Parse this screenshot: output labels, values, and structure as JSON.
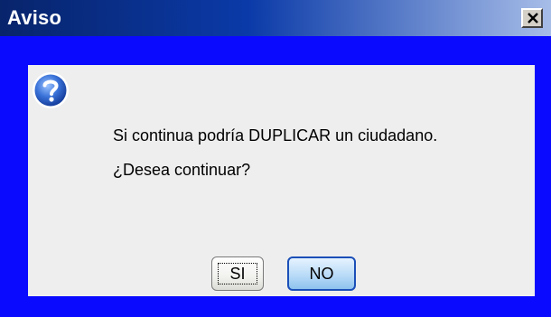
{
  "window": {
    "title": "Aviso"
  },
  "dialog": {
    "icon": "question-icon",
    "message_line1": "Si continua podría DUPLICAR un ciudadano.",
    "message_line2": "¿Desea continuar?",
    "yes_label": "SI",
    "no_label": "NO"
  },
  "colors": {
    "frame": "#0a0aff",
    "panel": "#eeeeee",
    "titlebar_start": "#08246b",
    "titlebar_end": "#a7bde8"
  }
}
